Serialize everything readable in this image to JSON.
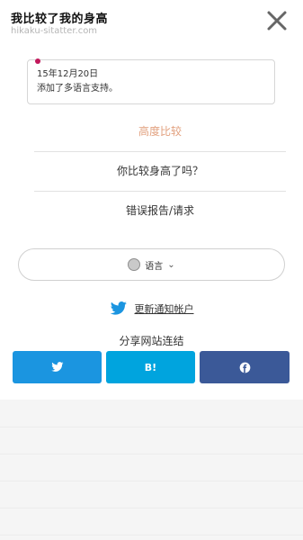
{
  "header": {
    "title": "我比较了我的身高",
    "url": "hikaku-sitatter.com"
  },
  "notice": {
    "date": "15年12月20日",
    "text": "添加了多语言支持。"
  },
  "menu": {
    "compare_label": "高度比较",
    "taller_label": "你比较身高了吗？",
    "report_label": "错误报告/请求"
  },
  "language": {
    "label": "语言"
  },
  "twitter": {
    "label": "更新通知帐户"
  },
  "share": {
    "title": "分享网站连结",
    "buttons": [
      {
        "service": "twitter",
        "icon": "twitter-bird-icon",
        "color": "#1b95e0"
      },
      {
        "service": "hatena",
        "label": "B!",
        "color": "#00a4de"
      },
      {
        "service": "facebook",
        "icon": "facebook-icon",
        "color": "#3b5998"
      }
    ]
  },
  "colors": {
    "accent_link": "#e2a07e",
    "twitter": "#1b95e0",
    "notice_dot": "#c2185b"
  }
}
